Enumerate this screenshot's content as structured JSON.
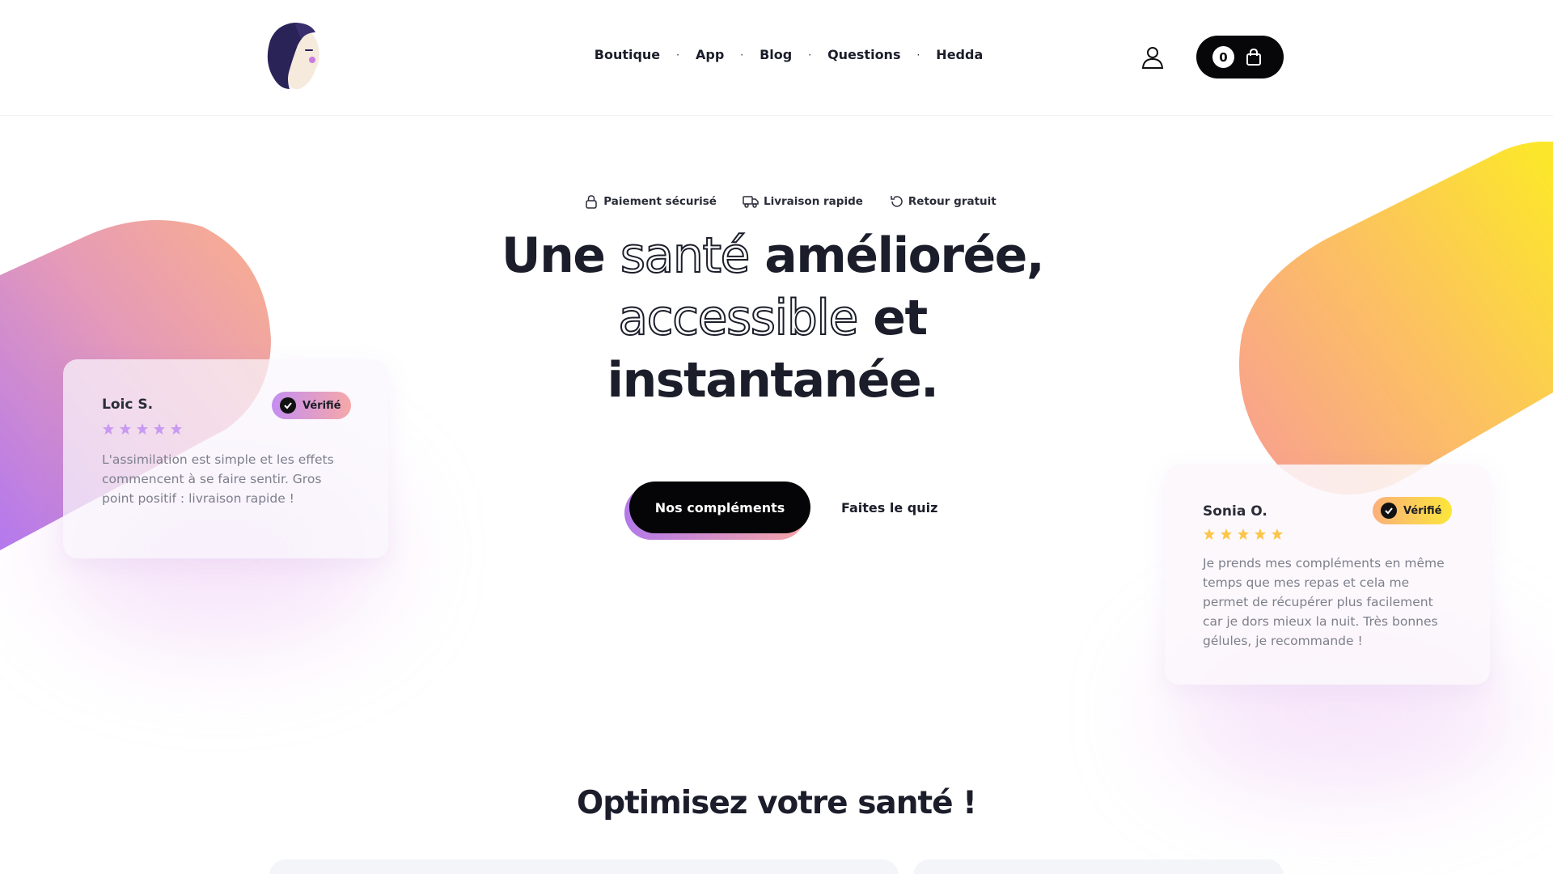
{
  "header": {
    "nav": [
      {
        "label": "Boutique"
      },
      {
        "label": "App"
      },
      {
        "label": "Blog"
      },
      {
        "label": "Questions"
      },
      {
        "label": "Hedda"
      }
    ],
    "cart_count": "0"
  },
  "trust": [
    {
      "label": "Paiement sécurisé",
      "icon": "lock-icon"
    },
    {
      "label": "Livraison rapide",
      "icon": "truck-icon"
    },
    {
      "label": "Retour gratuit",
      "icon": "return-icon"
    }
  ],
  "hero": {
    "line1_a": "Une ",
    "line1_outline": "santé",
    "line1_b": " améliorée,",
    "line2_outline": "accessible",
    "line2_b": " et",
    "line3": "instantanée.",
    "primary_cta": "Nos compléments",
    "secondary_cta": "Faites le quiz"
  },
  "reviews": [
    {
      "name": "Loic S.",
      "badge": "Vérifié",
      "rating": 5,
      "text": "L'assimilation est simple et les effets commencent à se faire sentir. Gros point positif : livraison rapide !"
    },
    {
      "name": "Sonia O.",
      "badge": "Vérifié",
      "rating": 5,
      "text": "Je prends mes compléments en même temps que mes repas et cela me permet de récupérer plus facilement car je dors mieux la nuit. Très bonnes gélules, je recommande !"
    }
  ],
  "section": {
    "title": "Optimisez votre santé !"
  },
  "colors": {
    "accent_purple": "#b27ae8",
    "accent_peach": "#f9a98a",
    "accent_yellow": "#fbe033",
    "text_dark": "#1b1d2a"
  }
}
